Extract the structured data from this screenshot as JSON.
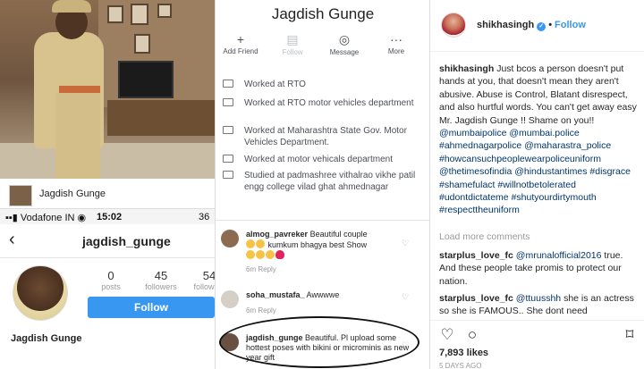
{
  "left": {
    "fb_name": "Jagdish Gunge",
    "status": {
      "carrier": "▪▪▮ Vodafone IN ◉",
      "time": "15:02",
      "battery": "36"
    },
    "ig": {
      "back": "‹",
      "username": "jagdish_gunge",
      "stats": [
        {
          "n": "0",
          "l": "posts"
        },
        {
          "n": "45",
          "l": "followers"
        },
        {
          "n": "54",
          "l": "following"
        }
      ],
      "follow_label": "Follow",
      "profile_name": "Jagdish Gunge"
    }
  },
  "mid": {
    "title": "Jagdish Gunge",
    "actions": [
      {
        "icon": "+",
        "label": "Add Friend"
      },
      {
        "icon": "▤",
        "label": "Follow"
      },
      {
        "icon": "◎",
        "label": "Message"
      },
      {
        "icon": "···",
        "label": "More"
      }
    ],
    "info": [
      "Worked at RTO",
      "Worked at RTO motor vehicles department",
      "Worked at Maharashtra State Gov. Motor Vehicles Department.",
      "Worked at motor vehicals department",
      "Studied at padmashree vithalrao vikhe patil engg college vilad ghat ahmednagar"
    ],
    "comments": [
      {
        "user": "almog_pavreker",
        "text": "Beautiful couple",
        "text2": "kumkum bhagya best Show",
        "meta": "6m   Reply"
      },
      {
        "user": "soha_mustafa_",
        "text": "Awwwwe",
        "meta": "6m   Reply"
      },
      {
        "user": "jagdish_gunge",
        "text": "Beautiful. Pl upload some hottest poses with bikini or microminis as new year gift"
      }
    ]
  },
  "right": {
    "username": "shikhasingh",
    "verified": "✓",
    "follow": "Follow",
    "dot": "•",
    "caption": {
      "user": "shikhasingh",
      "text": "Just bcos a person doesn't put hands at you, that doesn't mean they aren't abusive. Abuse is Control, Blatant disrespect, and also hurtful words. You can't get away easy Mr. Jagdish Gunge !! Shame on you!!",
      "tags": "@mumbaipolice @mumbai.police #ahmednagarpolice @maharastra_police #howcansuchpeoplewearpoliceuniform @thetimesofindia @hindustantimes #disgrace #shamefulact #willnotbetolerated #udontdictateme #shutyourdirtymouth #respecttheuniform"
    },
    "load_more": "Load more comments",
    "comments": [
      {
        "user": "starplus_love_fc",
        "mention": "@mrunalofficial2016",
        "text": "true. And these people take promis to protect our nation."
      },
      {
        "user": "starplus_love_fc",
        "mention": "@ttuusshh",
        "text": "she is an actress so she is FAMOUS.. She dont need"
      }
    ],
    "likes": "7,893 likes",
    "ago": "5 DAYS AGO"
  }
}
